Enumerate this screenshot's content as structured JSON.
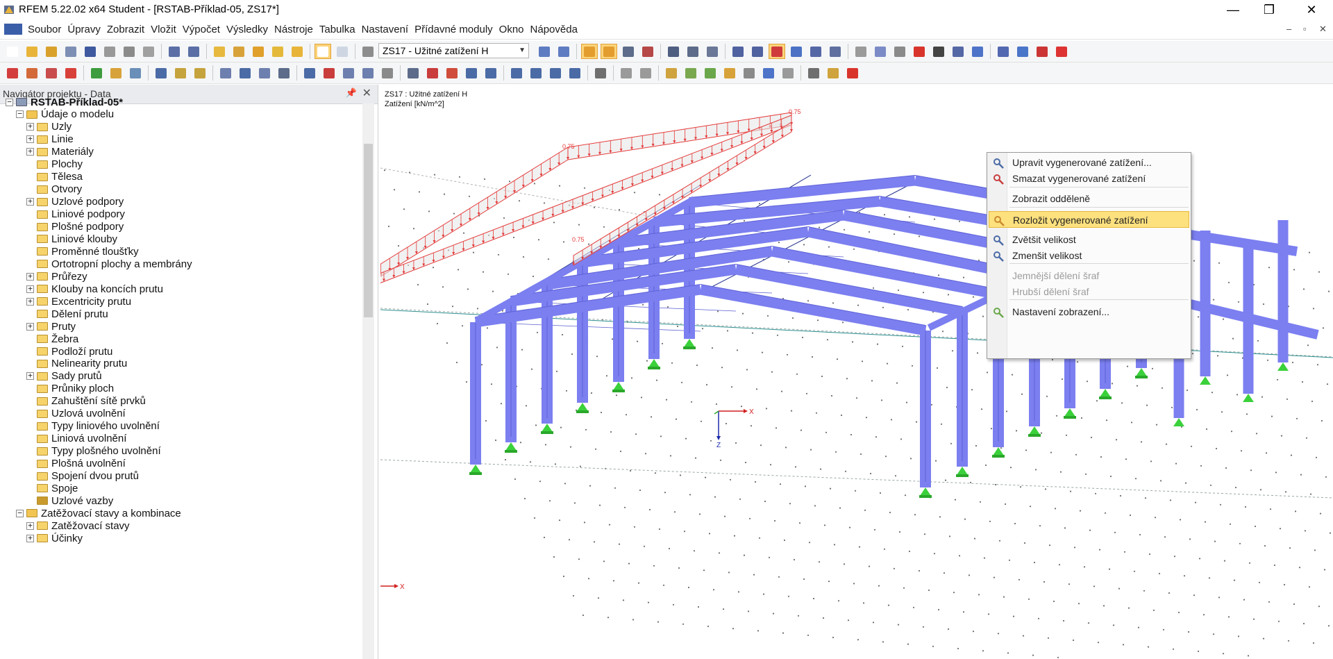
{
  "window": {
    "title": "RFEM 5.22.02 x64 Student - [RSTAB-Příklad-05, ZS17*]"
  },
  "menubar": {
    "items": [
      "Soubor",
      "Úpravy",
      "Zobrazit",
      "Vložit",
      "Výpočet",
      "Výsledky",
      "Nástroje",
      "Tabulka",
      "Nastavení",
      "Přídavné moduly",
      "Okno",
      "Nápověda"
    ]
  },
  "toolbar": {
    "load_case_select": "ZS17 - Užitné zatížení H"
  },
  "navigator": {
    "title": "Navigátor projektu - Data",
    "root": "RSTAB-Příklad-05*",
    "model_data": "Údaje o modelu",
    "items": [
      "Uzly",
      "Linie",
      "Materiály",
      "Plochy",
      "Tělesa",
      "Otvory",
      "Uzlové podpory",
      "Liniové podpory",
      "Plošné podpory",
      "Liniové klouby",
      "Proměnné tloušťky",
      "Ortotropní plochy a membrány",
      "Průřezy",
      "Klouby na koncích prutu",
      "Excentricity prutu",
      "Dělení prutu",
      "Pruty",
      "Žebra",
      "Podloží prutu",
      "Nelinearity prutu",
      "Sady prutů",
      "Průniky ploch",
      "Zahuštění sítě prvků",
      "Uzlová uvolnění",
      "Typy liniového uvolnění",
      "Liniová uvolnění",
      "Typy plošného uvolnění",
      "Plošná uvolnění",
      "Spojení dvou prutů",
      "Spoje",
      "Uzlové vazby"
    ],
    "load_group": "Zatěžovací stavy a kombinace",
    "load_items": [
      "Zatěžovací stavy",
      "Účinky"
    ]
  },
  "viewport": {
    "info_line1": "ZS17 : Užitné zatížení H",
    "info_line2": "Zatížení [kN/m^2]",
    "load_values": [
      "0.75",
      "0.75",
      "0.75",
      "0.75"
    ],
    "axis_labels": {
      "x": "X",
      "z": "Z"
    }
  },
  "context_menu": {
    "items": [
      "Upravit vygenerované zatížení...",
      "Smazat vygenerované zatížení",
      "Zobrazit odděleně",
      "Rozložit vygenerované zatížení",
      "Zvětšit velikost",
      "Zmenšit velikost",
      "Jemnější dělení šraf",
      "Hrubší dělení šraf",
      "Nastavení zobrazení..."
    ],
    "highlighted_index": 3,
    "disabled_indices": [
      6,
      7
    ]
  },
  "colors": {
    "member": "#7b7ff0",
    "load": "#e53a3a",
    "support": "#3bd13b",
    "highlight": "#fde17f"
  }
}
